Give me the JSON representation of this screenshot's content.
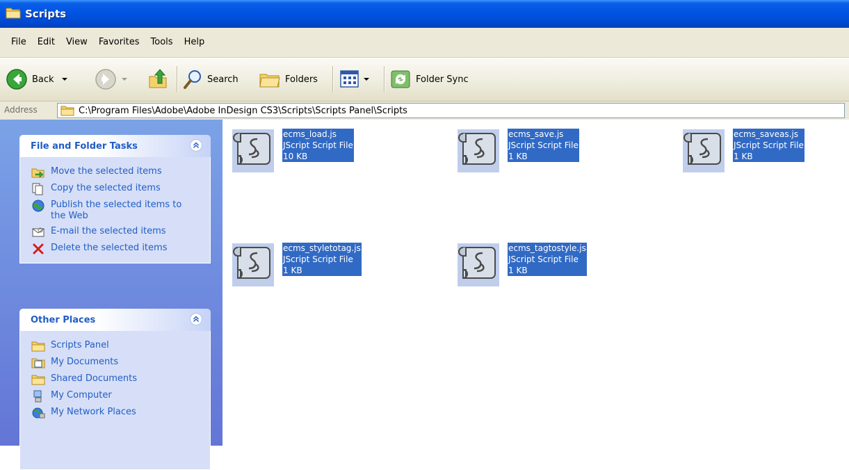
{
  "window": {
    "title": "Scripts"
  },
  "menu": [
    "File",
    "Edit",
    "View",
    "Favorites",
    "Tools",
    "Help"
  ],
  "toolbar": {
    "back_label": "Back",
    "search_label": "Search",
    "folders_label": "Folders",
    "folder_sync_label": "Folder Sync"
  },
  "address": {
    "label": "Address",
    "path": "C:\\Program Files\\Adobe\\Adobe InDesign CS3\\Scripts\\Scripts Panel\\Scripts"
  },
  "file_tasks": {
    "title": "File and Folder Tasks",
    "items": [
      {
        "label": "Move the selected items",
        "icon": "move-icon"
      },
      {
        "label": "Copy the selected items",
        "icon": "copy-icon"
      },
      {
        "label": "Publish the selected items to the Web",
        "icon": "globe-icon"
      },
      {
        "label": "E-mail the selected items",
        "icon": "email-icon"
      },
      {
        "label": "Delete the selected items",
        "icon": "delete-icon"
      }
    ]
  },
  "other_places": {
    "title": "Other Places",
    "items": [
      {
        "label": "Scripts Panel",
        "icon": "folder-icon"
      },
      {
        "label": "My Documents",
        "icon": "my-documents-icon"
      },
      {
        "label": "Shared Documents",
        "icon": "folder-icon"
      },
      {
        "label": "My Computer",
        "icon": "computer-icon"
      },
      {
        "label": "My Network Places",
        "icon": "network-icon"
      }
    ]
  },
  "files": [
    {
      "name": "ecms_load.js",
      "type": "JScript Script File",
      "size": "10 KB",
      "selected": true
    },
    {
      "name": "ecms_save.js",
      "type": "JScript Script File",
      "size": "1 KB",
      "selected": true
    },
    {
      "name": "ecms_saveas.js",
      "type": "JScript Script File",
      "size": "1 KB",
      "selected": true
    },
    {
      "name": "ecms_styletotag.js",
      "type": "JScript Script File",
      "size": "1 KB",
      "selected": true
    },
    {
      "name": "ecms_tagtostyle.js",
      "type": "JScript Script File",
      "size": "1 KB",
      "selected": true
    }
  ],
  "colors": {
    "titlebar": "#0054e3",
    "selection": "#316ac5",
    "task_link": "#215dc6",
    "sidepanel": "#7ba2e7"
  }
}
